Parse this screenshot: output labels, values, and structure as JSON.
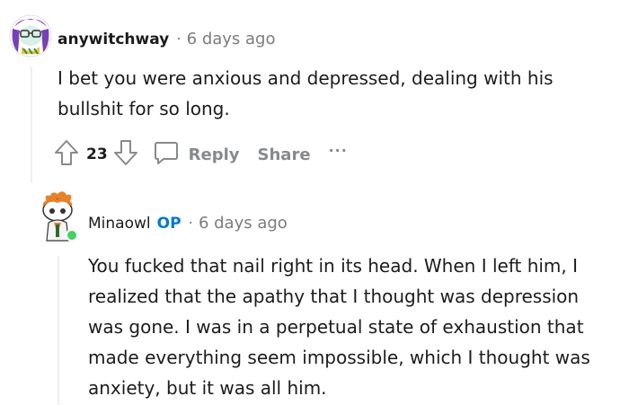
{
  "comment1": {
    "username": "anywitchway",
    "separator": "·",
    "time": "6 days ago",
    "body": "I bet you were anxious and depressed, dealing with his bullshit for so long.",
    "votes": "23",
    "reply_label": "Reply",
    "share_label": "Share",
    "more_label": "···"
  },
  "comment2": {
    "username": "Minaowl",
    "badge": "OP",
    "separator": "·",
    "time": "6 days ago",
    "body": "You fucked that nail right in its head. When I left him, I realized that the apathy that I thought was depression was gone. I was in a perpetual state of exhaustion that made everything seem impossible, which I thought was anxiety, but it was all him."
  },
  "colors": {
    "op_badge": "#0079d3",
    "muted": "#878a8c",
    "online_dot": "#46d160"
  }
}
